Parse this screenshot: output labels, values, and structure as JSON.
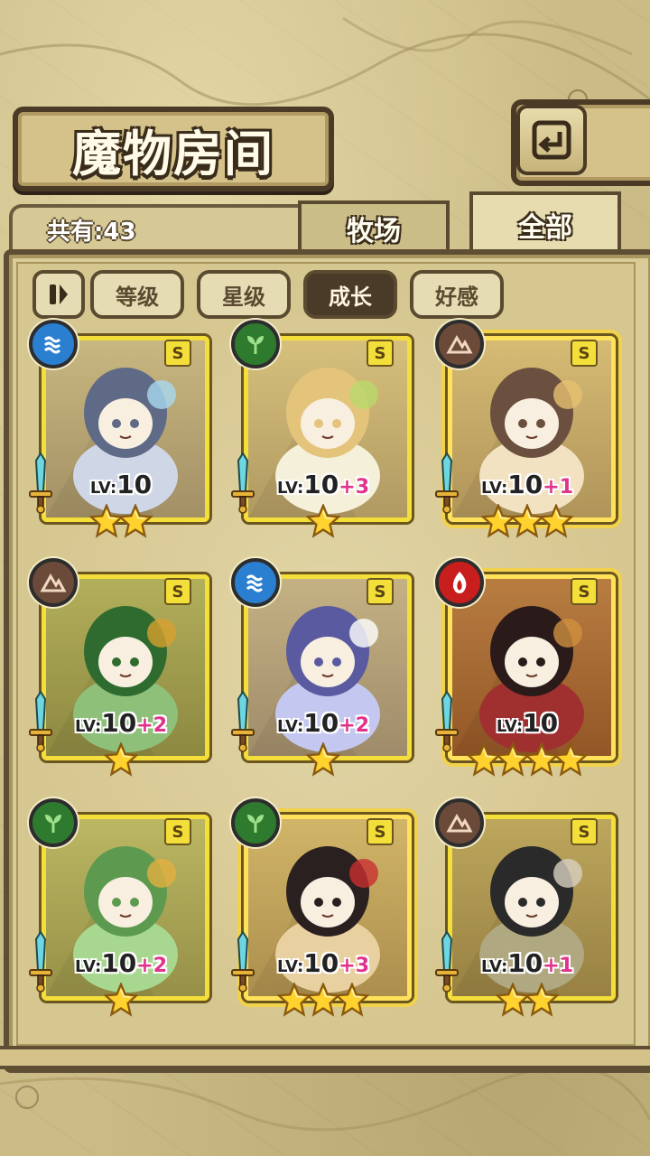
{
  "header": {
    "title": "魔物房间",
    "back_icon": "back-arrow-icon"
  },
  "info": {
    "total_label": "共有:43"
  },
  "tabs": [
    {
      "label": "牧场",
      "active": false
    },
    {
      "label": "全部",
      "active": true
    }
  ],
  "filters": {
    "sort_icon": "pause-sort-icon",
    "items": [
      {
        "label": "等级",
        "active": false
      },
      {
        "label": "星级",
        "active": false
      },
      {
        "label": "成长",
        "active": true
      },
      {
        "label": "好感",
        "active": false
      }
    ]
  },
  "colors": {
    "water": "#2a7fd0",
    "leaf": "#2e7a2e",
    "earth": "#6b4a3a",
    "fire": "#c81e1e",
    "frame_gold": "#f3de3a",
    "plus_pink": "#e0338a"
  },
  "monsters": [
    {
      "element": "water",
      "element_icon": "water-wave-icon",
      "grade": "S",
      "lv_prefix": "LV:",
      "level": "10",
      "plus": "",
      "stars": 2
    },
    {
      "element": "leaf",
      "element_icon": "leaf-icon",
      "grade": "S",
      "lv_prefix": "LV:",
      "level": "10",
      "plus": "+3",
      "stars": 1
    },
    {
      "element": "earth",
      "element_icon": "mountain-icon",
      "grade": "S",
      "lv_prefix": "LV:",
      "level": "10",
      "plus": "+1",
      "stars": 3
    },
    {
      "element": "earth",
      "element_icon": "mountain-icon",
      "grade": "S",
      "lv_prefix": "LV:",
      "level": "10",
      "plus": "+2",
      "stars": 1
    },
    {
      "element": "water",
      "element_icon": "water-wave-icon",
      "grade": "S",
      "lv_prefix": "LV:",
      "level": "10",
      "plus": "+2",
      "stars": 1
    },
    {
      "element": "fire",
      "element_icon": "flame-icon",
      "grade": "S",
      "lv_prefix": "LV:",
      "level": "10",
      "plus": "",
      "stars": 4
    },
    {
      "element": "leaf",
      "element_icon": "leaf-icon",
      "grade": "S",
      "lv_prefix": "LV:",
      "level": "10",
      "plus": "+2",
      "stars": 1
    },
    {
      "element": "leaf",
      "element_icon": "leaf-icon",
      "grade": "S",
      "lv_prefix": "LV:",
      "level": "10",
      "plus": "+3",
      "stars": 3
    },
    {
      "element": "earth",
      "element_icon": "mountain-icon",
      "grade": "S",
      "lv_prefix": "LV:",
      "level": "10",
      "plus": "+1",
      "stars": 2
    }
  ]
}
